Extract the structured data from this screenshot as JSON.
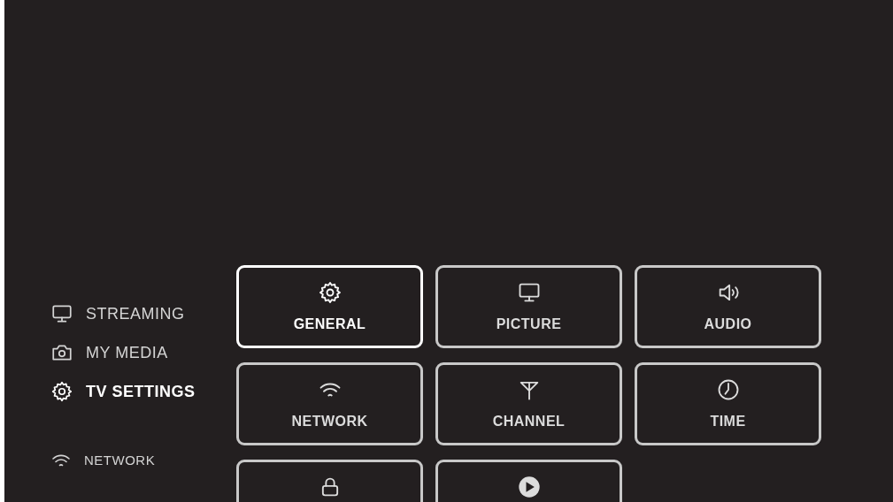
{
  "sidebar": {
    "items": [
      {
        "kind": "monitor",
        "label": "STREAMING",
        "selected": false
      },
      {
        "kind": "camera",
        "label": "MY MEDIA",
        "selected": false
      },
      {
        "kind": "gear",
        "label": "TV SETTINGS",
        "selected": true
      }
    ],
    "status": {
      "kind": "wifi",
      "label": "NETWORK"
    }
  },
  "tiles": [
    {
      "kind": "gear",
      "label": "GENERAL",
      "selected": true
    },
    {
      "kind": "monitor",
      "label": "PICTURE",
      "selected": false
    },
    {
      "kind": "speaker",
      "label": "AUDIO",
      "selected": false
    },
    {
      "kind": "wifi",
      "label": "NETWORK",
      "selected": false
    },
    {
      "kind": "antenna",
      "label": "CHANNEL",
      "selected": false
    },
    {
      "kind": "clock",
      "label": "TIME",
      "selected": false
    },
    {
      "kind": "lock",
      "selected": false
    },
    {
      "kind": "play",
      "selected": false
    }
  ]
}
